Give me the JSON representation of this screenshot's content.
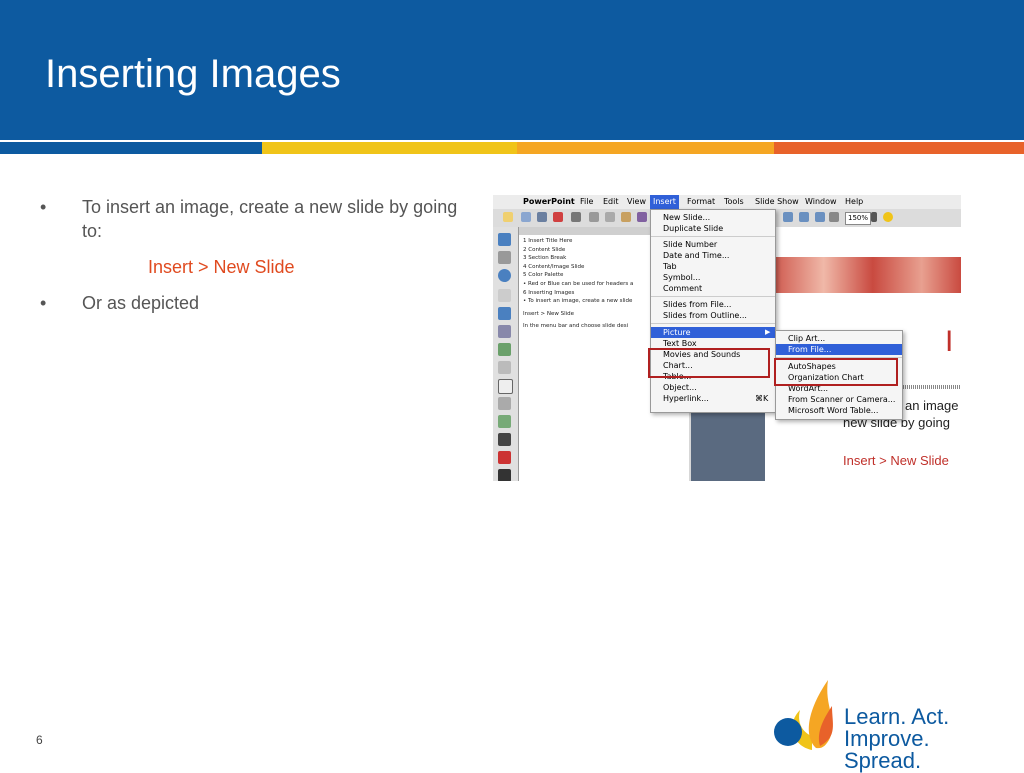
{
  "slide": {
    "title": "Inserting Images",
    "page_number": "6",
    "bullets": [
      {
        "text": "To insert an image, create a new slide by going to:"
      },
      {
        "text": "Or as depicted"
      }
    ],
    "sub_text": "Insert > New Slide"
  },
  "colors": {
    "header": "#0d5aa0",
    "accent_red": "#e04a1f",
    "stripe": [
      "#0d5aa0",
      "#f5a623",
      "#f0c419",
      "#f39c3b",
      "#e8622a"
    ]
  },
  "logo": {
    "line1": "Learn. Act.",
    "line2": "Improve. Spread."
  },
  "screenshot": {
    "app_name": "PowerPoint",
    "menus": [
      "File",
      "Edit",
      "View",
      "Insert",
      "Format",
      "Tools",
      "Slide Show",
      "Window",
      "Help"
    ],
    "zoom": "150%",
    "insert_menu": [
      "New Slide...",
      "Duplicate Slide",
      "Slide Number",
      "Date and Time...",
      "Tab",
      "Symbol...",
      "Comment",
      "Slides from File...",
      "Slides from Outline...",
      "Picture",
      "Text Box",
      "Movies and Sounds",
      "Chart...",
      "Table...",
      "Object...",
      "Hyperlink..."
    ],
    "hyperlink_shortcut": "⌘K",
    "picture_submenu": [
      "Clip Art...",
      "From File...",
      "AutoShapes",
      "Organization Chart",
      "WordArt...",
      "From Scanner or Camera...",
      "Microsoft Word Table..."
    ],
    "outline": [
      "1  Insert Title Here",
      "2  Content Slide",
      "3  Section Break",
      "4  Content/Image Slide",
      "5  Color Palette",
      "   • Red or Blue can be used for headers a",
      "6  Inserting Images",
      "   • To insert an image, create a new slide",
      "      Insert > New Slide",
      "      In the menu bar and choose slide desi"
    ],
    "slide_preview": {
      "title_fragment": "I",
      "line1": "an image",
      "line2": "new slide by going",
      "line3": "Insert > New Slide"
    }
  }
}
